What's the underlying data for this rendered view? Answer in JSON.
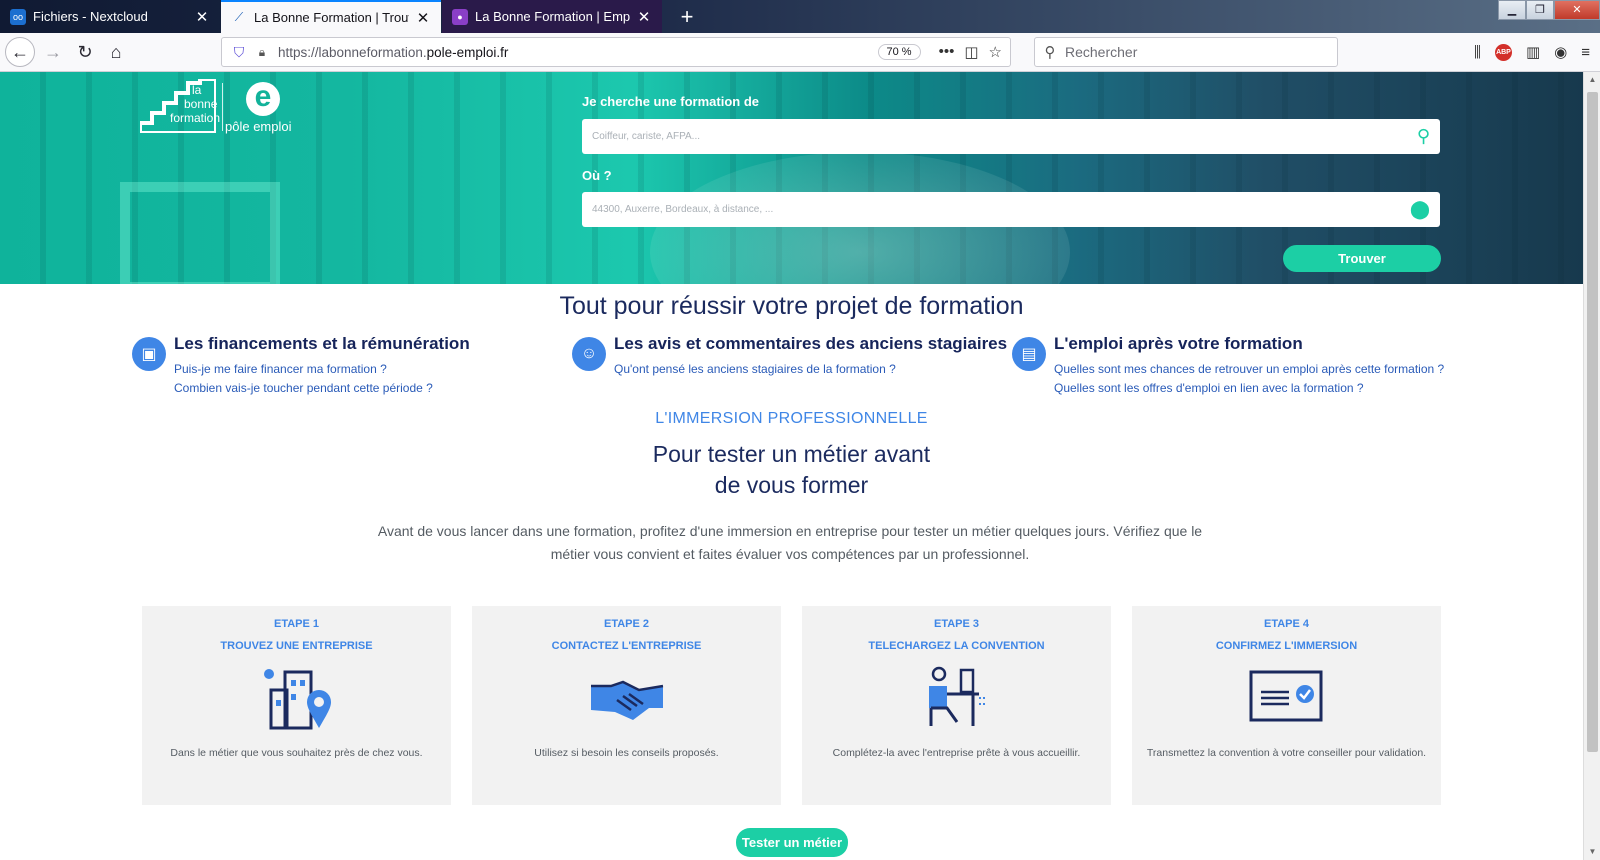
{
  "browser": {
    "tabs": [
      {
        "title": "Fichiers - Nextcloud",
        "active": false
      },
      {
        "title": "La Bonne Formation | Trouvez v",
        "active": true
      },
      {
        "title": "La Bonne Formation | Emploi S",
        "active": false
      }
    ],
    "url_prefix": "https://labonneformation.",
    "url_domain": "pole-emploi.fr",
    "zoom": "70 %",
    "search_placeholder": "Rechercher"
  },
  "hero": {
    "logo_text": [
      "la",
      "bonne",
      "formation"
    ],
    "logo_pe": "pôle emploi",
    "what_label": "Je cherche une formation de",
    "what_placeholder": "Coiffeur, cariste, AFPA...",
    "where_label": "Où ?",
    "where_placeholder": "44300, Auxerre, Bordeaux, à distance, ...",
    "find_button": "Trouver"
  },
  "section": {
    "title": "Tout pour réussir votre projet de formation",
    "features": [
      {
        "title": "Les financements et la rémunération",
        "links": [
          "Puis-je me faire financer ma formation ?",
          "Combien vais-je toucher pendant cette période ?"
        ],
        "icon": "wallet-icon"
      },
      {
        "title": "Les avis et commentaires des anciens stagiaires",
        "links": [
          "Qu'ont pensé les anciens stagiaires de la formation ?"
        ],
        "icon": "smiley-icon"
      },
      {
        "title": "L'emploi après votre formation",
        "links": [
          "Quelles sont mes chances de retrouver un emploi après cette formation ?",
          "Quelles sont les offres d'emploi en lien avec la formation ?"
        ],
        "icon": "document-icon"
      }
    ]
  },
  "immersion": {
    "kicker": "L'IMMERSION PROFESSIONNELLE",
    "title_line1": "Pour tester un métier avant",
    "title_line2": "de vous former",
    "intro_line1": "Avant de vous lancer dans une formation, profitez d'une immersion en entreprise pour tester un métier quelques jours. Vérifiez que le",
    "intro_line2": "métier vous convient et faites évaluer vos compétences par un professionnel.",
    "steps": [
      {
        "step": "ETAPE 1",
        "title": "TROUVEZ UNE ENTREPRISE",
        "desc": "Dans le métier que vous souhaitez près de chez vous.",
        "icon": "building-pin-icon"
      },
      {
        "step": "ETAPE 2",
        "title": "CONTACTEZ L'ENTREPRISE",
        "desc": "Utilisez si besoin les conseils proposés.",
        "icon": "handshake-icon"
      },
      {
        "step": "ETAPE 3",
        "title": "TELECHARGEZ LA CONVENTION",
        "desc": "Complétez-la avec l'entreprise prête à vous accueillir.",
        "icon": "person-at-desk-icon"
      },
      {
        "step": "ETAPE 4",
        "title": "CONFIRMEZ L'IMMERSION",
        "desc": "Transmettez la convention à votre conseiller pour validation.",
        "icon": "certificate-check-icon"
      }
    ],
    "cta": "Tester un métier"
  },
  "colors": {
    "accent": "#1ccfa5",
    "blue": "#3f86e6",
    "navy": "#1b2a5e"
  }
}
